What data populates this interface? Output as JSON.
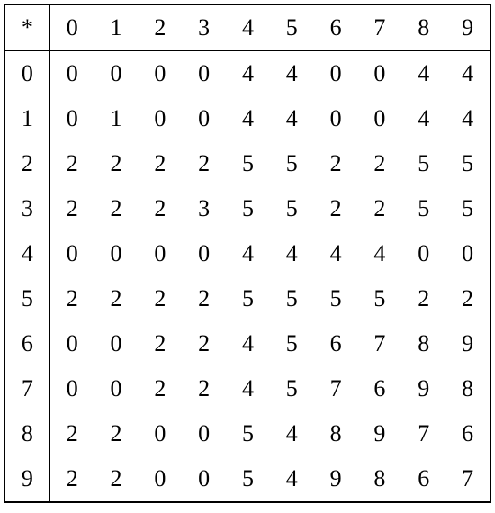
{
  "chart_data": {
    "type": "table",
    "title": "",
    "corner_symbol": "*",
    "col_headers": [
      "0",
      "1",
      "2",
      "3",
      "4",
      "5",
      "6",
      "7",
      "8",
      "9"
    ],
    "row_headers": [
      "0",
      "1",
      "2",
      "3",
      "4",
      "5",
      "6",
      "7",
      "8",
      "9"
    ],
    "rows": [
      [
        "0",
        "0",
        "0",
        "0",
        "4",
        "4",
        "0",
        "0",
        "4",
        "4"
      ],
      [
        "0",
        "1",
        "0",
        "0",
        "4",
        "4",
        "0",
        "0",
        "4",
        "4"
      ],
      [
        "2",
        "2",
        "2",
        "2",
        "5",
        "5",
        "2",
        "2",
        "5",
        "5"
      ],
      [
        "2",
        "2",
        "2",
        "3",
        "5",
        "5",
        "2",
        "2",
        "5",
        "5"
      ],
      [
        "0",
        "0",
        "0",
        "0",
        "4",
        "4",
        "4",
        "4",
        "0",
        "0"
      ],
      [
        "2",
        "2",
        "2",
        "2",
        "5",
        "5",
        "5",
        "5",
        "2",
        "2"
      ],
      [
        "0",
        "0",
        "2",
        "2",
        "4",
        "5",
        "6",
        "7",
        "8",
        "9"
      ],
      [
        "0",
        "0",
        "2",
        "2",
        "4",
        "5",
        "7",
        "6",
        "9",
        "8"
      ],
      [
        "2",
        "2",
        "0",
        "0",
        "5",
        "4",
        "8",
        "9",
        "7",
        "6"
      ],
      [
        "2",
        "2",
        "0",
        "0",
        "5",
        "4",
        "9",
        "8",
        "6",
        "7"
      ]
    ]
  }
}
